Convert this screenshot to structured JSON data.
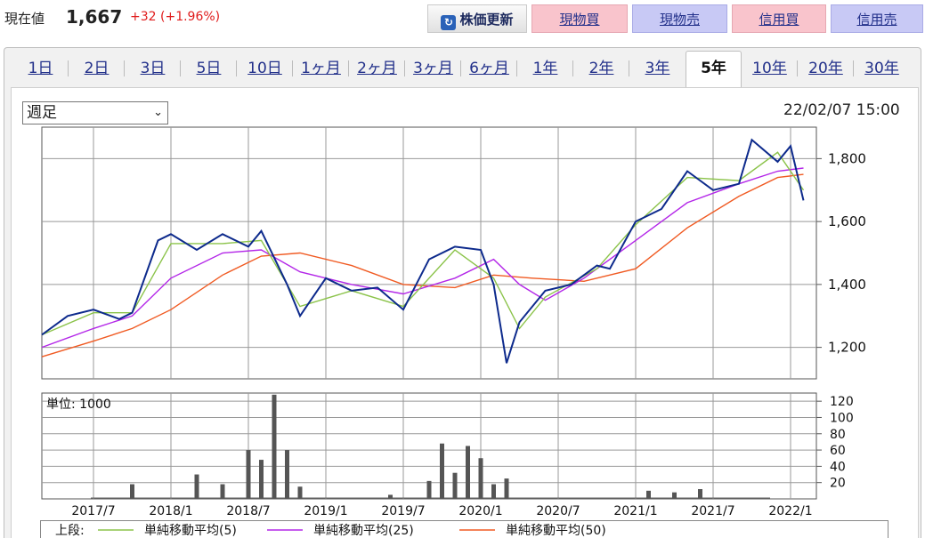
{
  "header": {
    "price_label": "現在値",
    "price_value": "1,667",
    "price_change": "+32 (+1.96%)",
    "refresh_label": "株価更新",
    "buttons": [
      "現物買",
      "現物売",
      "信用買",
      "信用売"
    ],
    "colors": {
      "up": "#e01b1b",
      "buy": "#f9c4cc",
      "sell": "#c8c9f5"
    }
  },
  "tabs": {
    "items": [
      "1日",
      "2日",
      "3日",
      "5日",
      "10日",
      "1ヶ月",
      "2ヶ月",
      "3ヶ月",
      "6ヶ月",
      "1年",
      "2年",
      "3年",
      "5年",
      "10年",
      "20年",
      "30年"
    ],
    "active": "5年"
  },
  "controls": {
    "interval": "週足",
    "timestamp": "22/02/07 15:00"
  },
  "chart_data": [
    {
      "type": "line",
      "series": [
        {
          "name": "price",
          "color": "#0d2a8c",
          "x": [
            "2017-03",
            "2017-05",
            "2017-07",
            "2017-09",
            "2017-10",
            "2017-12",
            "2018-01",
            "2018-03",
            "2018-05",
            "2018-07",
            "2018-08",
            "2018-10",
            "2018-11",
            "2019-01",
            "2019-03",
            "2019-05",
            "2019-07",
            "2019-09",
            "2019-11",
            "2020-01",
            "2020-02",
            "2020-03",
            "2020-04",
            "2020-06",
            "2020-08",
            "2020-10",
            "2020-11",
            "2021-01",
            "2021-03",
            "2021-05",
            "2021-07",
            "2021-09",
            "2021-10",
            "2021-12",
            "2022-01",
            "2022-02"
          ],
          "values": [
            1240,
            1300,
            1320,
            1290,
            1310,
            1540,
            1560,
            1510,
            1560,
            1520,
            1570,
            1400,
            1300,
            1420,
            1380,
            1390,
            1320,
            1480,
            1520,
            1510,
            1400,
            1150,
            1280,
            1380,
            1400,
            1460,
            1450,
            1600,
            1640,
            1760,
            1700,
            1720,
            1860,
            1790,
            1840,
            1667
          ]
        },
        {
          "name": "単純移動平均(5)",
          "color": "#8bc34a",
          "x": [
            "2017-03",
            "2017-07",
            "2017-10",
            "2018-01",
            "2018-05",
            "2018-08",
            "2018-11",
            "2019-03",
            "2019-07",
            "2019-11",
            "2020-02",
            "2020-04",
            "2020-06",
            "2020-10",
            "2021-01",
            "2021-05",
            "2021-09",
            "2021-12",
            "2022-02"
          ],
          "values": [
            1240,
            1310,
            1310,
            1530,
            1530,
            1540,
            1330,
            1380,
            1330,
            1510,
            1420,
            1260,
            1360,
            1450,
            1590,
            1740,
            1730,
            1820,
            1700
          ]
        },
        {
          "name": "単純移動平均(25)",
          "color": "#b326e8",
          "x": [
            "2017-03",
            "2017-07",
            "2017-10",
            "2018-01",
            "2018-05",
            "2018-08",
            "2018-11",
            "2019-03",
            "2019-07",
            "2019-11",
            "2020-02",
            "2020-04",
            "2020-06",
            "2020-09",
            "2021-01",
            "2021-05",
            "2021-09",
            "2021-12",
            "2022-02"
          ],
          "values": [
            1200,
            1260,
            1300,
            1420,
            1500,
            1510,
            1440,
            1400,
            1370,
            1420,
            1480,
            1400,
            1350,
            1420,
            1540,
            1660,
            1720,
            1760,
            1770
          ]
        },
        {
          "name": "単純移動平均(50)",
          "color": "#f05a22",
          "x": [
            "2017-03",
            "2017-07",
            "2017-10",
            "2018-01",
            "2018-05",
            "2018-08",
            "2018-11",
            "2019-03",
            "2019-07",
            "2019-11",
            "2020-02",
            "2020-05",
            "2020-09",
            "2021-01",
            "2021-05",
            "2021-09",
            "2021-12",
            "2022-02"
          ],
          "values": [
            1170,
            1220,
            1260,
            1320,
            1430,
            1490,
            1500,
            1460,
            1400,
            1390,
            1430,
            1420,
            1410,
            1450,
            1580,
            1680,
            1740,
            1750
          ]
        }
      ],
      "ylim": [
        1100,
        1900
      ],
      "yticks": [
        "1,200",
        "1,400",
        "1,600",
        "1,800"
      ],
      "ytick_values": [
        1200,
        1400,
        1600,
        1800
      ],
      "grid": true
    },
    {
      "type": "bar",
      "ylabel": "単位: 1000",
      "yticks": [
        "20",
        "40",
        "60",
        "80",
        "100",
        "120"
      ],
      "ytick_values": [
        20,
        40,
        60,
        80,
        100,
        120
      ],
      "ylim": [
        0,
        130
      ],
      "x": [
        "2017-10",
        "2018-03",
        "2018-05",
        "2018-07",
        "2018-08",
        "2018-09",
        "2018-10",
        "2018-11",
        "2019-06",
        "2019-09",
        "2019-10",
        "2019-11",
        "2019-12",
        "2020-01",
        "2020-02",
        "2020-03",
        "2021-02",
        "2021-04",
        "2021-06"
      ],
      "values": [
        18,
        30,
        18,
        60,
        48,
        128,
        60,
        15,
        5,
        22,
        68,
        32,
        65,
        50,
        18,
        25,
        10,
        8,
        12
      ],
      "xticks": [
        "2017/7",
        "2018/1",
        "2018/7",
        "2019/1",
        "2019/7",
        "2020/1",
        "2020/7",
        "2021/1",
        "2021/7",
        "2022/1"
      ]
    }
  ],
  "legend": {
    "title": "上段:",
    "items": [
      {
        "label": "単純移動平均(5)",
        "color": "#8bc34a"
      },
      {
        "label": "単純移動平均(25)",
        "color": "#b326e8"
      },
      {
        "label": "単純移動平均(50)",
        "color": "#f05a22"
      }
    ]
  }
}
